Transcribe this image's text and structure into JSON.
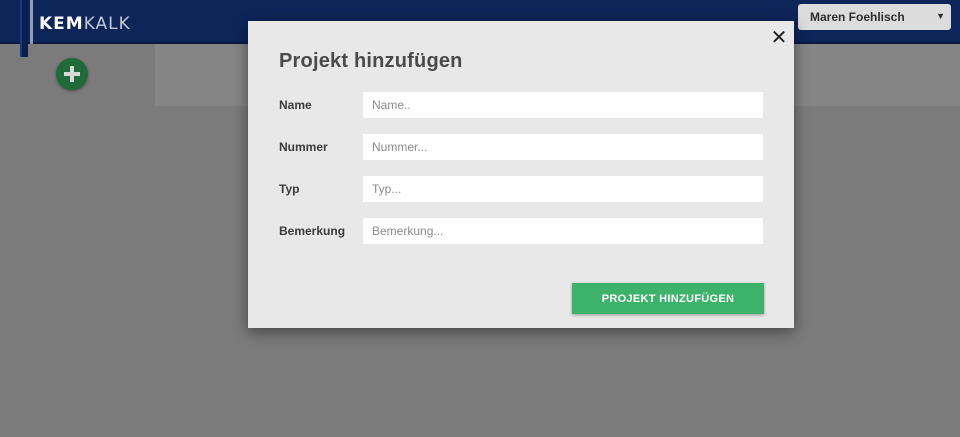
{
  "header": {
    "logo_part1": "KEM",
    "logo_part2": "KALK",
    "user_name": "Maren Foehlisch",
    "user_menu_icon": "caret-down-icon"
  },
  "toolbar": {
    "add_icon": "plus-circle-icon"
  },
  "modal": {
    "title": "Projekt hinzufügen",
    "close_label": "✕",
    "fields": [
      {
        "label": "Name",
        "placeholder": "Name..",
        "value": ""
      },
      {
        "label": "Nummer",
        "placeholder": "Nummer...",
        "value": ""
      },
      {
        "label": "Typ",
        "placeholder": "Typ...",
        "value": ""
      },
      {
        "label": "Bemerkung",
        "placeholder": "Bemerkung...",
        "value": ""
      }
    ],
    "submit_label": "PROJEKT HINZUFÜGEN"
  },
  "colors": {
    "header_bg": "#0d2559",
    "overlay": "#7b7b7b",
    "modal_bg": "#e8e8e8",
    "submit_bg": "#3cb26a",
    "fab_bg": "#1f6b3a"
  }
}
